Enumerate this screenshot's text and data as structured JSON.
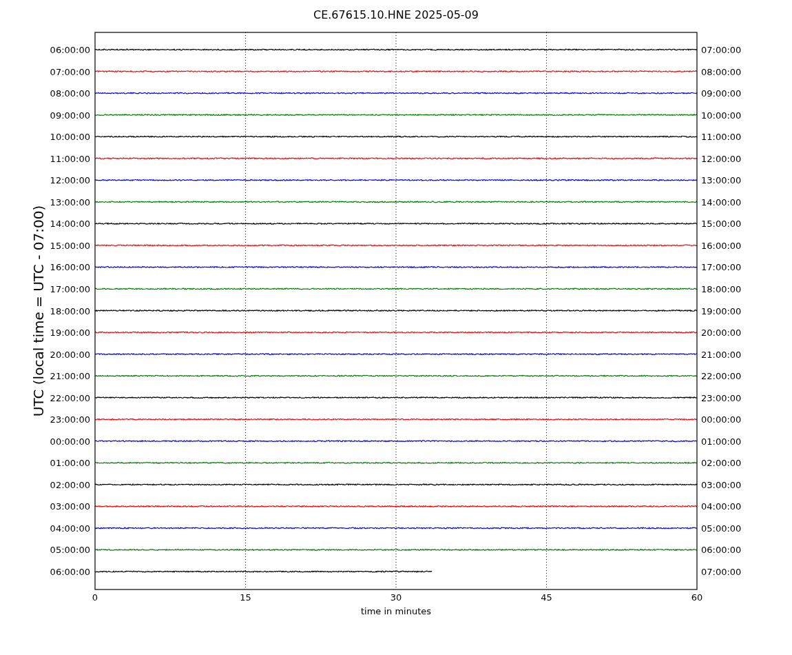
{
  "plot": {
    "title": "CE.67615.10.HNE 2025-05-09",
    "y_axis_label": "UTC (local time = UTC - 07:00)",
    "x_axis": {
      "label": "time in minutes",
      "ticks": [
        "0",
        "15",
        "30",
        "45",
        "60"
      ]
    },
    "traces": [
      {
        "left_label": "06:00:00",
        "right_label": "07:00:00",
        "color": "#000000",
        "level": 1
      },
      {
        "left_label": "07:00:00",
        "right_label": "08:00:00",
        "color": "#ff0000",
        "level": 1
      },
      {
        "left_label": "08:00:00",
        "right_label": "09:00:00",
        "color": "#0000ff",
        "level": 1
      },
      {
        "left_label": "09:00:00",
        "right_label": "10:00:00",
        "color": "#008000",
        "level": 1
      },
      {
        "left_label": "10:00:00",
        "right_label": "11:00:00",
        "color": "#000000",
        "level": 1
      },
      {
        "left_label": "11:00:00",
        "right_label": "12:00:00",
        "color": "#ff0000",
        "level": 1
      },
      {
        "left_label": "12:00:00",
        "right_label": "13:00:00",
        "color": "#0000ff",
        "level": 1
      },
      {
        "left_label": "13:00:00",
        "right_label": "14:00:00",
        "color": "#008000",
        "level": 1
      },
      {
        "left_label": "14:00:00",
        "right_label": "15:00:00",
        "color": "#000000",
        "level": 1
      },
      {
        "left_label": "15:00:00",
        "right_label": "16:00:00",
        "color": "#ff0000",
        "level": 1
      },
      {
        "left_label": "16:00:00",
        "right_label": "17:00:00",
        "color": "#0000ff",
        "level": 1
      },
      {
        "left_label": "17:00:00",
        "right_label": "18:00:00",
        "color": "#008000",
        "level": 1
      },
      {
        "left_label": "18:00:00",
        "right_label": "19:00:00",
        "color": "#000000",
        "level": 1
      },
      {
        "left_label": "19:00:00",
        "right_label": "20:00:00",
        "color": "#ff0000",
        "level": 1
      },
      {
        "left_label": "20:00:00",
        "right_label": "21:00:00",
        "color": "#0000ff",
        "level": 1
      },
      {
        "left_label": "21:00:00",
        "right_label": "22:00:00",
        "color": "#008000",
        "level": 1
      },
      {
        "left_label": "22:00:00",
        "right_label": "23:00:00",
        "color": "#000000",
        "level": 1
      },
      {
        "left_label": "23:00:00",
        "right_label": "00:00:00",
        "color": "#ff0000",
        "level": 1
      },
      {
        "left_label": "00:00:00",
        "right_label": "01:00:00",
        "color": "#0000ff",
        "level": 1
      },
      {
        "left_label": "01:00:00",
        "right_label": "02:00:00",
        "color": "#008000",
        "level": 1
      },
      {
        "left_label": "02:00:00",
        "right_label": "03:00:00",
        "color": "#000000",
        "level": 1
      },
      {
        "left_label": "03:00:00",
        "right_label": "04:00:00",
        "color": "#ff0000",
        "level": 1
      },
      {
        "left_label": "04:00:00",
        "right_label": "05:00:00",
        "color": "#0000ff",
        "level": 1
      },
      {
        "left_label": "05:00:00",
        "right_label": "06:00:00",
        "color": "#008000",
        "level": 1
      },
      {
        "left_label": "06:00:00",
        "right_label": "07:00:00",
        "color": "#000000",
        "level": 0.56
      }
    ]
  }
}
